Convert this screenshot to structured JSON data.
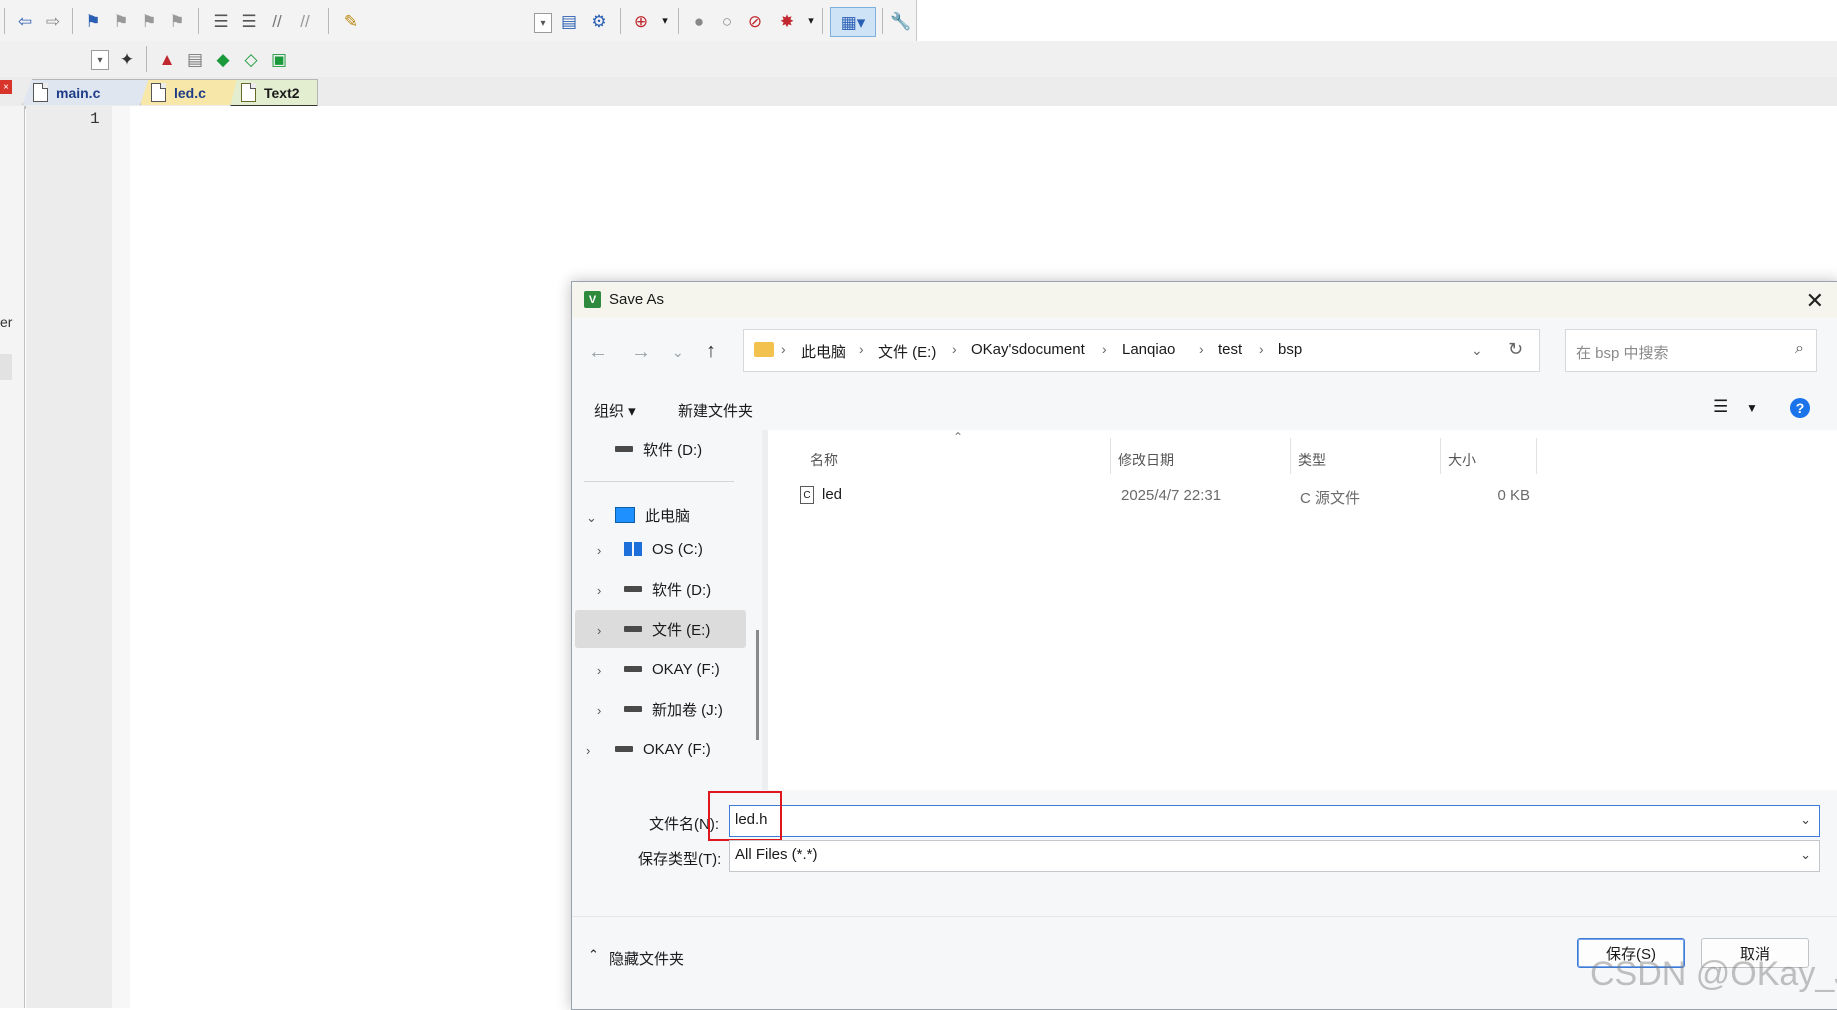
{
  "editor": {
    "tabs": [
      {
        "label": "main.c"
      },
      {
        "label": "led.c"
      },
      {
        "label": "Text2"
      }
    ],
    "line_number": "1",
    "side_text": "er"
  },
  "dialog": {
    "title": "Save As",
    "breadcrumb": [
      "此电脑",
      "文件 (E:)",
      "OKay'sdocument",
      "Lanqiao",
      "test",
      "bsp"
    ],
    "search_placeholder": "在 bsp 中搜索",
    "commands": {
      "organize": "组织",
      "new_folder": "新建文件夹"
    },
    "nav_tree": [
      {
        "label": "软件 (D:)"
      },
      {
        "label": "此电脑"
      },
      {
        "label": "OS (C:)"
      },
      {
        "label": "软件 (D:)"
      },
      {
        "label": "文件 (E:)"
      },
      {
        "label": "OKAY (F:)"
      },
      {
        "label": "新加卷 (J:)"
      },
      {
        "label": "OKAY (F:)"
      }
    ],
    "columns": {
      "name": "名称",
      "modified": "修改日期",
      "type": "类型",
      "size": "大小"
    },
    "files": [
      {
        "name": "led",
        "modified": "2025/4/7 22:31",
        "type": "C 源文件",
        "size": "0 KB"
      }
    ],
    "filename_label": "文件名(N):",
    "filename_value": "led.h",
    "filetype_label": "保存类型(T):",
    "filetype_value": "All Files (*.*)",
    "hide_folders": "隐藏文件夹",
    "save_button": "保存(S)",
    "cancel_button": "取消"
  },
  "watermark": "CSDN @OKay_J",
  "colors": {
    "accent": "#3d7bd9",
    "highlight": "#e0161d"
  }
}
